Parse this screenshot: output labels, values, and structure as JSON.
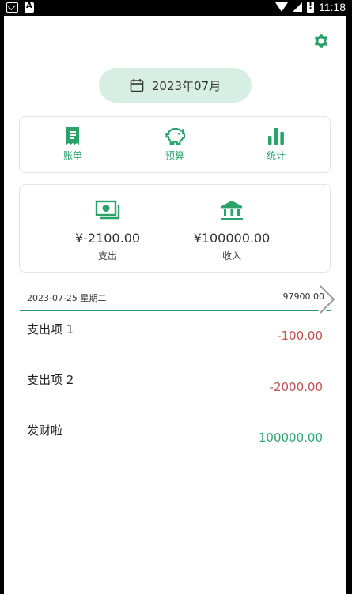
{
  "status": {
    "time": "11:18"
  },
  "header": {
    "month": "2023年07月"
  },
  "nav": [
    {
      "label": "账单",
      "icon": "receipt-icon"
    },
    {
      "label": "预算",
      "icon": "piggy-bank-icon"
    },
    {
      "label": "统计",
      "icon": "bar-chart-icon"
    }
  ],
  "summary": {
    "expense_value": "¥-2100.00",
    "expense_label": "支出",
    "income_value": "¥100000.00",
    "income_label": "收入"
  },
  "day": {
    "date": "2023-07-25 星期二",
    "total": "97900.00"
  },
  "entries": [
    {
      "title": "支出项 1",
      "amount": "-100.00",
      "kind": "expense"
    },
    {
      "title": "支出项 2",
      "amount": "-2000.00",
      "kind": "expense"
    },
    {
      "title": "发财啦",
      "amount": "100000.00",
      "kind": "income"
    }
  ],
  "colors": {
    "accent": "#2aa36b",
    "pill": "#d6eee3",
    "expense": "#c0504d",
    "income": "#2fa56f"
  }
}
